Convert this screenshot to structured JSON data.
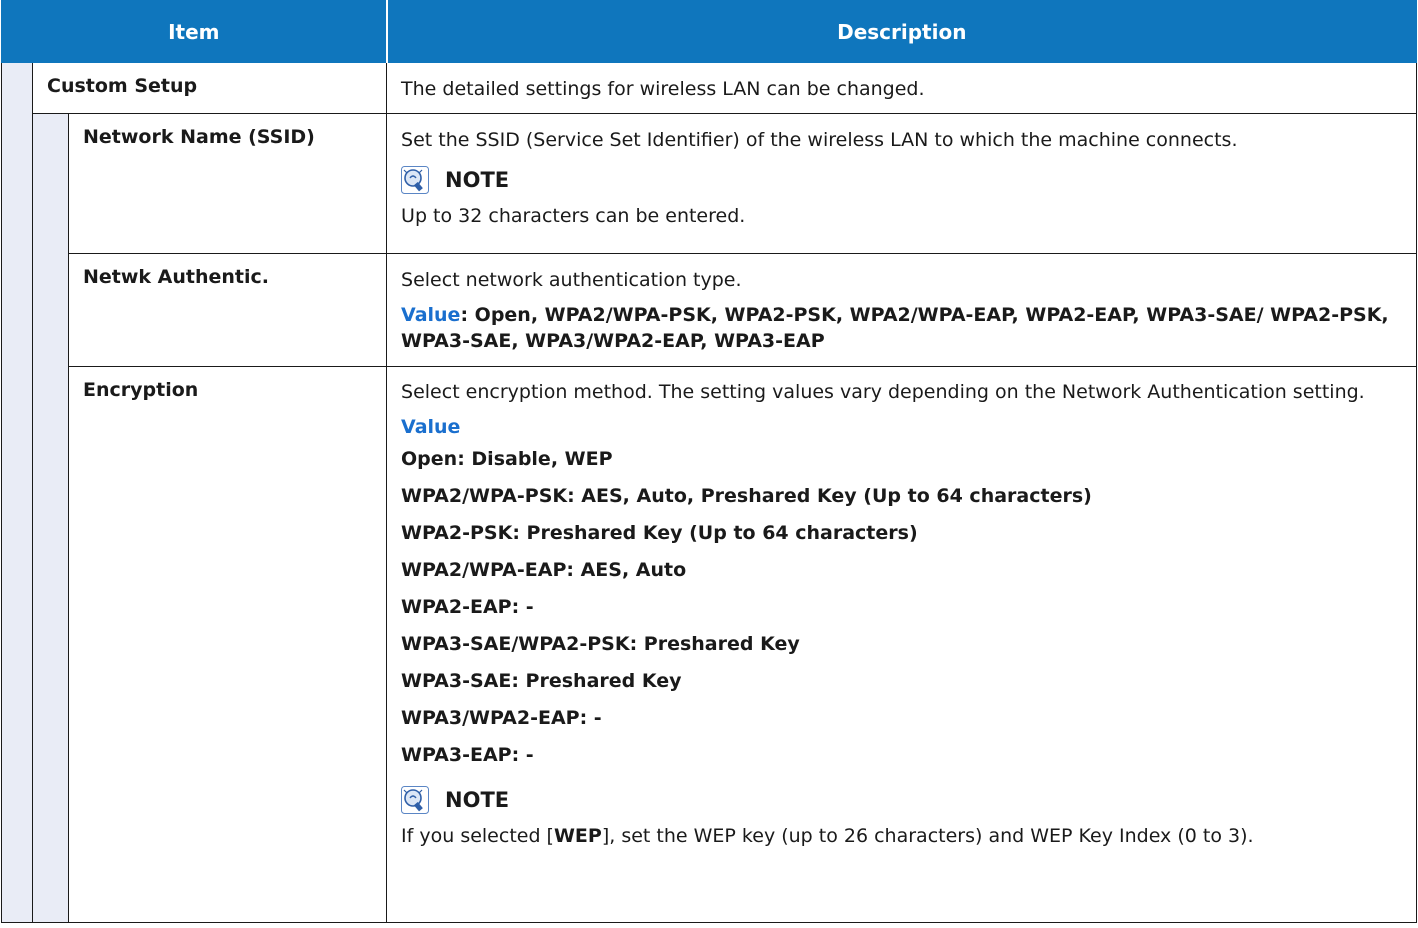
{
  "header": {
    "item": "Item",
    "description": "Description"
  },
  "rows": {
    "custom_setup": {
      "name": "Custom Setup",
      "desc": "The detailed settings for wireless LAN can be changed."
    },
    "ssid": {
      "name": "Network Name (SSID)",
      "desc": "Set the SSID (Service Set Identifier) of the wireless LAN to which the machine connects.",
      "note_title": "NOTE",
      "note_text": "Up to 32 characters can be entered."
    },
    "auth": {
      "name": "Netwk Authentic.",
      "desc": "Select network authentication type.",
      "value_label": "Value",
      "value_text": ": Open, WPA2/WPA-PSK, WPA2-PSK, WPA2/WPA-EAP, WPA2-EAP, WPA3-SAE/ WPA2-PSK, WPA3-SAE, WPA3/WPA2-EAP, WPA3-EAP"
    },
    "encryption": {
      "name": "Encryption",
      "desc": "Select encryption method. The setting values vary depending on the Network Authentication setting.",
      "value_label": "Value",
      "values": [
        "Open: Disable, WEP",
        "WPA2/WPA-PSK: AES, Auto, Preshared Key (Up to 64 characters)",
        "WPA2-PSK: Preshared Key (Up to 64 characters)",
        "WPA2/WPA-EAP: AES, Auto",
        "WPA2-EAP: -",
        "WPA3-SAE/WPA2-PSK: Preshared Key",
        "WPA3-SAE: Preshared Key",
        "WPA3/WPA2-EAP: -",
        "WPA3-EAP: -"
      ],
      "note_title": "NOTE",
      "note_before": "If you selected [",
      "note_bold": "WEP",
      "note_after": "], set the WEP key (up to 26 characters) and WEP Key Index (0 to 3)."
    }
  },
  "icon": "note-lightbulb-icon",
  "colors": {
    "header_bg": "#0f76bd",
    "value_label": "#1a6fce",
    "indent_bg": "#e9ecf6"
  }
}
